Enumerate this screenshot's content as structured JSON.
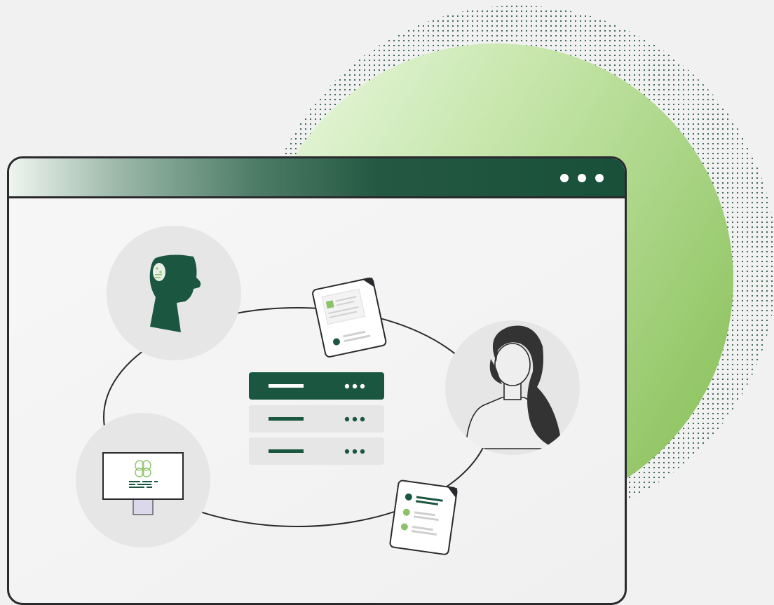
{
  "colors": {
    "accent_dark_green": "#1b5740",
    "accent_light_green": "#8bc468",
    "frame": "#2a2a2e",
    "circle_bg": "#e6e6e6",
    "page_bg": "#f1f1f1"
  },
  "icons": {
    "head": "head-silhouette-icon",
    "person": "woman-avatar-icon",
    "monitor": "monitor-brain-icon",
    "document": "document-icon",
    "checklist": "checklist-icon",
    "server": "server-stack-icon"
  },
  "window": {
    "controls": [
      "dot",
      "dot",
      "dot"
    ]
  }
}
